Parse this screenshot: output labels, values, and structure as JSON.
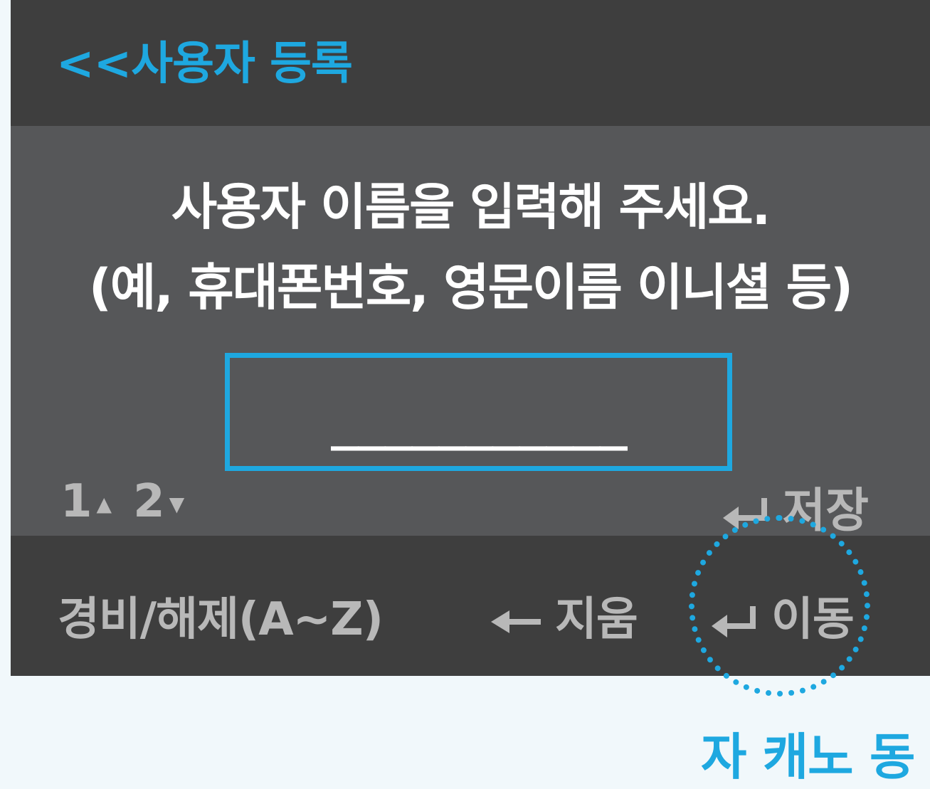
{
  "header": {
    "title": "<<사용자 등록"
  },
  "prompt": {
    "line1": "사용자 이름을 입력해 주세요.",
    "line2": "(예, 휴대폰번호, 영문이름 이니셜 등)"
  },
  "input": {
    "value": "___________"
  },
  "page_nav": {
    "page1": "1",
    "page1_icon": "up-triangle-icon",
    "page2": "2",
    "page2_icon": "down-triangle-icon"
  },
  "save": {
    "icon": "enter-icon",
    "label": "저장"
  },
  "footer": {
    "arm_label": "경비/해제(A~Z)",
    "delete_icon": "left-arrow-icon",
    "delete_label": "지움",
    "move_icon": "enter-icon",
    "move_label": "이동"
  },
  "below": {
    "partial_text": "자 캐노 동"
  },
  "colors": {
    "accent": "#1ea8e0",
    "panel": "#565759",
    "bar": "#3e3e3e",
    "muted_text": "#b8b8b8",
    "page_bg": "#f1f8fb"
  }
}
